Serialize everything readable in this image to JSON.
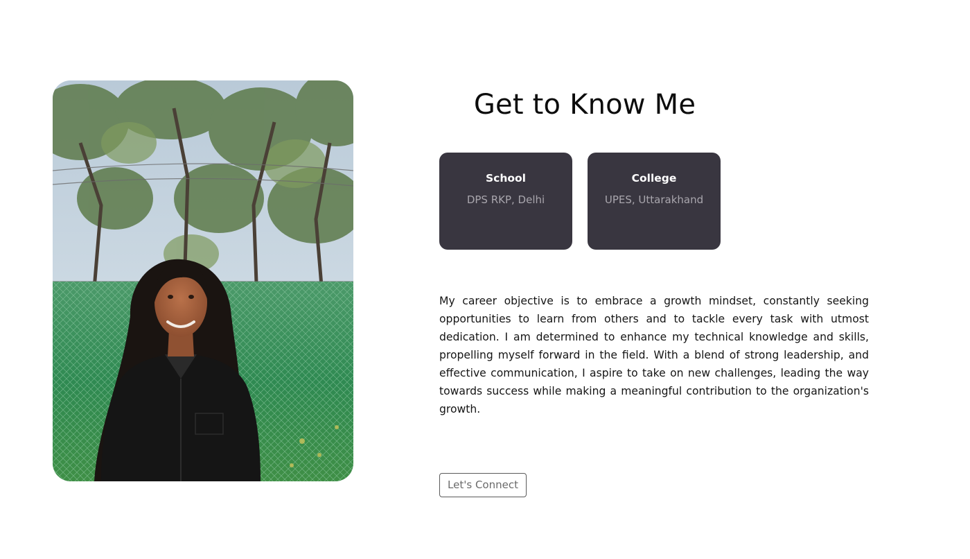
{
  "about": {
    "title": "Get to Know Me",
    "photo_alt": "Portrait photo",
    "education": {
      "school": {
        "heading": "School",
        "value": "DPS RKP, Delhi"
      },
      "college": {
        "heading": "College",
        "value": "UPES, Uttarakhand"
      }
    },
    "objective": "My career objective is to embrace a growth mindset, constantly seeking opportunities to learn from others and to tackle every task with utmost dedication. I am determined to enhance my technical knowledge and skills, propelling myself forward in the field. With a blend of strong leadership, and effective communication, I aspire to take on new challenges, leading the way towards success while making a meaningful contribution to the organization's growth.",
    "connect_label": "Let's Connect"
  },
  "colors": {
    "card_bg": "#393640",
    "card_heading": "#ffffff",
    "card_text": "#a9a6ad",
    "button_border": "#5a5a5a"
  }
}
